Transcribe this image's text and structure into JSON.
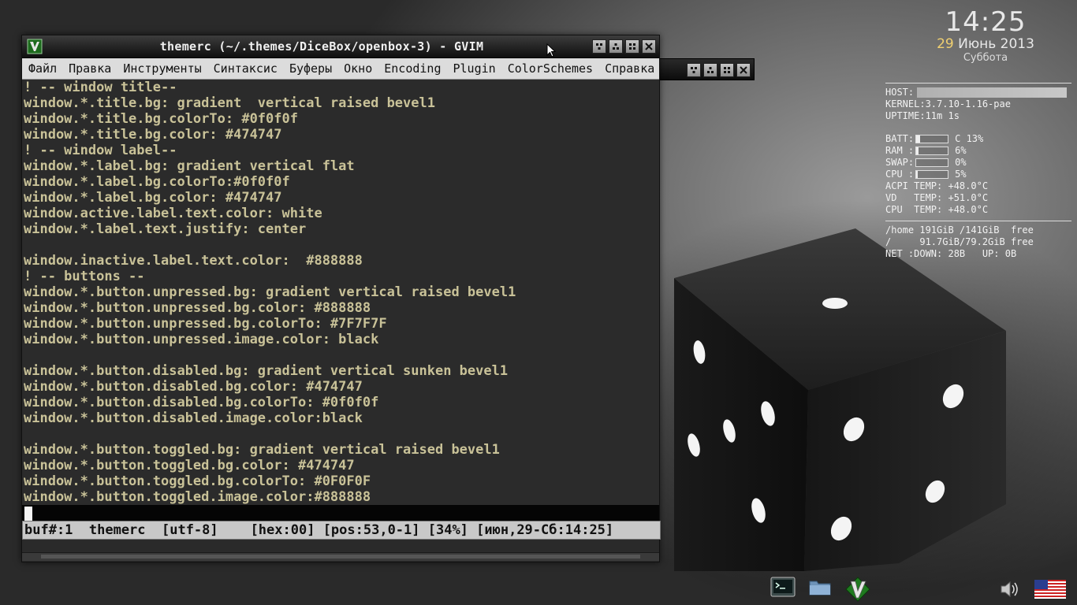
{
  "window": {
    "title": "themerc (~/.themes/DiceBox/openbox-3) - GVIM",
    "app_icon": "vim-icon"
  },
  "menu": [
    {
      "label": "Файл"
    },
    {
      "label": "Правка"
    },
    {
      "label": "Инструменты"
    },
    {
      "label": "Синтаксис"
    },
    {
      "label": "Буферы"
    },
    {
      "label": "Окно"
    },
    {
      "label": "Encoding"
    },
    {
      "label": "Plugin"
    },
    {
      "label": "ColorSchemes"
    },
    {
      "label": "Справка"
    }
  ],
  "editor": {
    "lines": [
      "! -- window title--",
      "window.*.title.bg: gradient  vertical raised bevel1",
      "window.*.title.bg.colorTo: #0f0f0f",
      "window.*.title.bg.color: #474747",
      "! -- window label--",
      "window.*.label.bg: gradient vertical flat",
      "window.*.label.bg.colorTo:#0f0f0f",
      "window.*.label.bg.color: #474747",
      "window.active.label.text.color: white",
      "window.*.label.text.justify: center",
      "",
      "window.inactive.label.text.color:  #888888",
      "! -- buttons --",
      "window.*.button.unpressed.bg: gradient vertical raised bevel1",
      "window.*.button.unpressed.bg.color: #888888",
      "window.*.button.unpressed.bg.colorTo: #7F7F7F",
      "window.*.button.unpressed.image.color: black",
      "",
      "window.*.button.disabled.bg: gradient vertical sunken bevel1",
      "window.*.button.disabled.bg.color: #474747",
      "window.*.button.disabled.bg.colorTo: #0f0f0f",
      "window.*.button.disabled.image.color:black",
      "",
      "window.*.button.toggled.bg: gradient vertical raised bevel1",
      "window.*.button.toggled.bg.color: #474747",
      "window.*.button.toggled.bg.colorTo: #0F0F0F",
      "window.*.button.toggled.image.color:#888888"
    ],
    "statusline": "buf#:1  themerc  [utf-8]    [hex:00] [pos:53,0-1] [34%] [июн,29-Сб:14:25]"
  },
  "clock": {
    "time": "14:25",
    "day": "29",
    "month_year": " Июнь 2013",
    "weekday": "Суббота"
  },
  "conky": {
    "host_label": "HOST:",
    "kernel": "KERNEL:3.7.10-1.16-pae",
    "uptime": "UPTIME:11m 1s",
    "batt_label": "BATT:",
    "batt_value": "C 13%",
    "batt_level": 0.13,
    "ram_label": "RAM :",
    "ram_value": "6%",
    "ram_level": 0.06,
    "swap_label": "SWAP:",
    "swap_value": "0%",
    "swap_level": 0.0,
    "cpu_label": "CPU :",
    "cpu_value": "5%",
    "cpu_level": 0.05,
    "acpi_temp": "ACPI TEMP: +48.0°C",
    "vd_temp": "VD   TEMP: +51.0°C",
    "cpu_temp": "CPU  TEMP: +48.0°C",
    "home_disk": "/home 191GiB /141GiB  free",
    "root_disk": "/     91.7GiB/79.2GiB free",
    "net": "NET :DOWN: 28B   UP: 0B"
  },
  "tray": {
    "items": [
      "terminal-icon",
      "folder-icon",
      "vim-icon",
      "volume-icon",
      "us-flag-icon"
    ]
  },
  "colors": {
    "editor_bg": "#2b2b2b",
    "editor_fg": "#c9c298",
    "statusline_bg": "#c8c8c8",
    "clock_day": "#f0d070"
  }
}
